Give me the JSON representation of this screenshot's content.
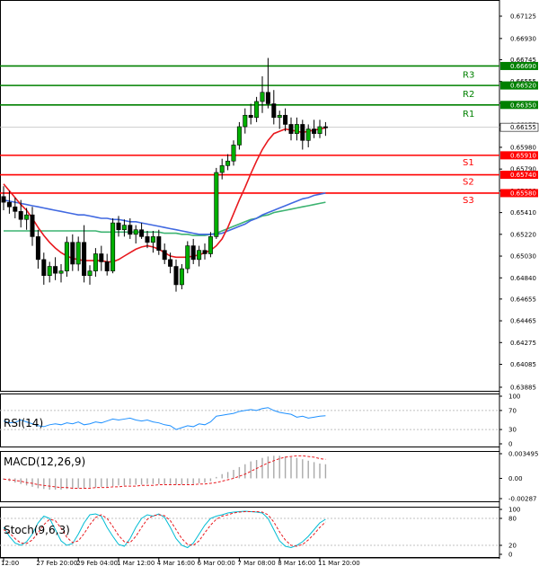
{
  "chart_data": {
    "type": "candlestick",
    "price_axis": {
      "ticks": [
        "0.67125",
        "0.66930",
        "0.66745",
        "0.66555",
        "0.66365",
        "0.66175",
        "0.65980",
        "0.65790",
        "0.65600",
        "0.65410",
        "0.65220",
        "0.65030",
        "0.64840",
        "0.64655",
        "0.64465",
        "0.64275",
        "0.64085",
        "0.63885"
      ],
      "ylim": [
        0.63885,
        0.67125
      ]
    },
    "time_axis": {
      "ticks": [
        "12:00",
        "27 Feb 20:00",
        "29 Feb 04:00",
        "1 Mar 12:00",
        "4 Mar 16:00",
        "6 Mar 00:00",
        "7 Mar 08:00",
        "8 Mar 16:00",
        "11 Mar 20:00"
      ]
    },
    "levels": [
      {
        "name": "R3",
        "value": "0.66690",
        "color": "#008000"
      },
      {
        "name": "R2",
        "value": "0.66520",
        "color": "#008000"
      },
      {
        "name": "R1",
        "value": "0.66350",
        "color": "#008000"
      },
      {
        "name": "S1",
        "value": "0.65910",
        "color": "#ff0000"
      },
      {
        "name": "S2",
        "value": "0.65740",
        "color": "#ff0000"
      },
      {
        "name": "S3",
        "value": "0.65580",
        "color": "#ff0000"
      }
    ],
    "current_price": "0.66155",
    "candles": [
      [
        0.6555,
        0.6564,
        0.6543,
        0.655
      ],
      [
        0.655,
        0.656,
        0.654,
        0.6546
      ],
      [
        0.6546,
        0.6554,
        0.6536,
        0.6542
      ],
      [
        0.6542,
        0.6552,
        0.6528,
        0.6535
      ],
      [
        0.6535,
        0.6545,
        0.6526,
        0.6539
      ],
      [
        0.6539,
        0.6546,
        0.6512,
        0.652
      ],
      [
        0.652,
        0.6526,
        0.6492,
        0.65
      ],
      [
        0.65,
        0.6506,
        0.6478,
        0.6486
      ],
      [
        0.6486,
        0.6498,
        0.648,
        0.6494
      ],
      [
        0.6494,
        0.6502,
        0.6482,
        0.6488
      ],
      [
        0.6488,
        0.6496,
        0.648,
        0.649
      ],
      [
        0.649,
        0.652,
        0.6485,
        0.6515
      ],
      [
        0.6515,
        0.6522,
        0.649,
        0.6496
      ],
      [
        0.6496,
        0.652,
        0.649,
        0.6515
      ],
      [
        0.6515,
        0.653,
        0.648,
        0.6486
      ],
      [
        0.6486,
        0.6495,
        0.6478,
        0.649
      ],
      [
        0.649,
        0.651,
        0.6485,
        0.6505
      ],
      [
        0.6505,
        0.6512,
        0.649,
        0.6498
      ],
      [
        0.6498,
        0.6505,
        0.6486,
        0.649
      ],
      [
        0.649,
        0.6536,
        0.6488,
        0.6532
      ],
      [
        0.6532,
        0.6538,
        0.652,
        0.6526
      ],
      [
        0.6526,
        0.6535,
        0.652,
        0.653
      ],
      [
        0.653,
        0.6536,
        0.6518,
        0.6522
      ],
      [
        0.6522,
        0.653,
        0.6514,
        0.6526
      ],
      [
        0.6526,
        0.6532,
        0.6518,
        0.652
      ],
      [
        0.652,
        0.6525,
        0.651,
        0.6515
      ],
      [
        0.6515,
        0.6525,
        0.6506,
        0.652
      ],
      [
        0.652,
        0.6526,
        0.6504,
        0.6508
      ],
      [
        0.6508,
        0.6514,
        0.6496,
        0.65
      ],
      [
        0.65,
        0.6506,
        0.6488,
        0.6494
      ],
      [
        0.6494,
        0.65,
        0.6472,
        0.6478
      ],
      [
        0.6478,
        0.6496,
        0.6474,
        0.6492
      ],
      [
        0.6492,
        0.6516,
        0.6488,
        0.6512
      ],
      [
        0.6512,
        0.6518,
        0.6496,
        0.65
      ],
      [
        0.65,
        0.6512,
        0.6494,
        0.6508
      ],
      [
        0.6508,
        0.6514,
        0.65,
        0.6505
      ],
      [
        0.6505,
        0.6524,
        0.6502,
        0.652
      ],
      [
        0.652,
        0.658,
        0.6518,
        0.6576
      ],
      [
        0.6576,
        0.6588,
        0.657,
        0.6582
      ],
      [
        0.6582,
        0.6592,
        0.6578,
        0.6586
      ],
      [
        0.6586,
        0.6604,
        0.6582,
        0.66
      ],
      [
        0.66,
        0.662,
        0.6596,
        0.6616
      ],
      [
        0.6616,
        0.6632,
        0.661,
        0.6626
      ],
      [
        0.6626,
        0.6636,
        0.6618,
        0.6624
      ],
      [
        0.6624,
        0.6642,
        0.662,
        0.6638
      ],
      [
        0.6638,
        0.666,
        0.6628,
        0.6646
      ],
      [
        0.6646,
        0.6676,
        0.6632,
        0.6636
      ],
      [
        0.6636,
        0.6648,
        0.6618,
        0.6624
      ],
      [
        0.6624,
        0.663,
        0.6614,
        0.6626
      ],
      [
        0.6626,
        0.6632,
        0.6612,
        0.6618
      ],
      [
        0.6618,
        0.6624,
        0.6604,
        0.661
      ],
      [
        0.661,
        0.6624,
        0.6604,
        0.6618
      ],
      [
        0.6618,
        0.6622,
        0.6596,
        0.6604
      ],
      [
        0.6604,
        0.6618,
        0.6598,
        0.6614
      ],
      [
        0.6614,
        0.6622,
        0.6606,
        0.661
      ],
      [
        0.661,
        0.6622,
        0.6606,
        0.6616
      ],
      [
        0.6616,
        0.662,
        0.6608,
        0.6615
      ]
    ],
    "ma_red": [
      0.6566,
      0.656,
      0.6554,
      0.6548,
      0.6543,
      0.6536,
      0.6528,
      0.6521,
      0.6515,
      0.651,
      0.6506,
      0.6503,
      0.6501,
      0.65,
      0.6499,
      0.6499,
      0.6499,
      0.6499,
      0.6498,
      0.6498,
      0.65,
      0.6503,
      0.6506,
      0.6509,
      0.6511,
      0.6512,
      0.6511,
      0.6509,
      0.6506,
      0.6503,
      0.6502,
      0.6502,
      0.6502,
      0.6503,
      0.6504,
      0.6506,
      0.6508,
      0.6512,
      0.6518,
      0.6528,
      0.654,
      0.6552,
      0.6563,
      0.6575,
      0.6586,
      0.6596,
      0.6604,
      0.661,
      0.6612,
      0.6614,
      0.6613,
      0.6612,
      0.6611,
      0.6612,
      0.6613,
      0.6614,
      0.6615
    ],
    "ma_blue": [
      0.6552,
      0.6551,
      0.655,
      0.6549,
      0.6548,
      0.6547,
      0.6546,
      0.6545,
      0.6544,
      0.6543,
      0.6542,
      0.6541,
      0.654,
      0.6539,
      0.6539,
      0.6538,
      0.6537,
      0.6536,
      0.6536,
      0.6535,
      0.6535,
      0.6534,
      0.6533,
      0.6533,
      0.6532,
      0.6531,
      0.653,
      0.6529,
      0.6528,
      0.6527,
      0.6526,
      0.6525,
      0.6524,
      0.6523,
      0.6522,
      0.6522,
      0.6522,
      0.6522,
      0.6523,
      0.6525,
      0.6527,
      0.6529,
      0.6531,
      0.6534,
      0.6536,
      0.6539,
      0.6541,
      0.6543,
      0.6545,
      0.6547,
      0.6549,
      0.6551,
      0.6553,
      0.6554,
      0.6556,
      0.6557,
      0.6558
    ],
    "ma_green": [
      0.6525,
      0.6525,
      0.6525,
      0.6525,
      0.6525,
      0.6525,
      0.6525,
      0.6525,
      0.6525,
      0.6525,
      0.6525,
      0.6525,
      0.6525,
      0.6525,
      0.6525,
      0.6525,
      0.6525,
      0.6524,
      0.6524,
      0.6524,
      0.6524,
      0.6524,
      0.6524,
      0.6524,
      0.6524,
      0.6524,
      0.6524,
      0.6524,
      0.6523,
      0.6523,
      0.6523,
      0.6522,
      0.6522,
      0.6521,
      0.6521,
      0.6521,
      0.6522,
      0.6523,
      0.6525,
      0.6527,
      0.6529,
      0.6531,
      0.6533,
      0.6535,
      0.6536,
      0.6538,
      0.6539,
      0.6541,
      0.6542,
      0.6543,
      0.6544,
      0.6545,
      0.6546,
      0.6547,
      0.6548,
      0.6549,
      0.655
    ],
    "rsi": {
      "label": "RSI(14)",
      "ticks": [
        "100",
        "70",
        "30",
        "0"
      ],
      "ylim": [
        0,
        100
      ],
      "values": [
        48,
        44,
        45,
        50,
        46,
        42,
        38,
        36,
        40,
        42,
        40,
        44,
        42,
        46,
        40,
        42,
        46,
        44,
        48,
        52,
        50,
        52,
        54,
        50,
        48,
        50,
        46,
        44,
        40,
        38,
        30,
        34,
        38,
        36,
        42,
        40,
        46,
        58,
        60,
        62,
        64,
        68,
        70,
        72,
        70,
        74,
        76,
        70,
        66,
        64,
        62,
        56,
        58,
        54,
        56,
        58,
        59
      ]
    },
    "macd": {
      "label": "MACD(12,26,9)",
      "ticks": [
        "0.003495",
        "0.00",
        "-0.00287"
      ],
      "ylim": [
        -0.00287,
        0.003495
      ],
      "hist": [
        -0.0002,
        -0.0004,
        -0.0006,
        -0.0008,
        -0.001,
        -0.0012,
        -0.0014,
        -0.0015,
        -0.0016,
        -0.0016,
        -0.0016,
        -0.0015,
        -0.0015,
        -0.0014,
        -0.0014,
        -0.0013,
        -0.0013,
        -0.0012,
        -0.0012,
        -0.0011,
        -0.001,
        -0.001,
        -0.0009,
        -0.0009,
        -0.0009,
        -0.0008,
        -0.0008,
        -0.0008,
        -0.0008,
        -0.0008,
        -0.0009,
        -0.0009,
        -0.0008,
        -0.0008,
        -0.0007,
        -0.0006,
        -0.0004,
        0.0002,
        0.0006,
        0.0009,
        0.0012,
        0.0016,
        0.002,
        0.0024,
        0.0026,
        0.0029,
        0.0031,
        0.0032,
        0.0032,
        0.0031,
        0.003,
        0.0029,
        0.0027,
        0.0025,
        0.0023,
        0.0021,
        0.002
      ],
      "signal": [
        -0.0001,
        -0.0002,
        -0.0003,
        -0.0004,
        -0.0006,
        -0.0007,
        -0.0009,
        -0.001,
        -0.0011,
        -0.0012,
        -0.0013,
        -0.0013,
        -0.0014,
        -0.0014,
        -0.0014,
        -0.0014,
        -0.0013,
        -0.0013,
        -0.0013,
        -0.0012,
        -0.0012,
        -0.0011,
        -0.0011,
        -0.0011,
        -0.001,
        -0.001,
        -0.001,
        -0.0009,
        -0.0009,
        -0.0009,
        -0.0009,
        -0.0009,
        -0.0009,
        -0.0009,
        -0.0008,
        -0.0008,
        -0.0007,
        -0.0006,
        -0.0004,
        -0.0002,
        0.0,
        0.0003,
        0.0006,
        0.001,
        0.0014,
        0.0018,
        0.0022,
        0.0025,
        0.0028,
        0.003,
        0.0031,
        0.0032,
        0.0032,
        0.0031,
        0.003,
        0.0028,
        0.0027
      ]
    },
    "stoch": {
      "label": "Stoch(9,6,3)",
      "ticks": [
        "100",
        "80",
        "20",
        "0"
      ],
      "ylim": [
        0,
        100
      ],
      "k": [
        60,
        40,
        25,
        20,
        28,
        45,
        70,
        85,
        80,
        55,
        30,
        20,
        24,
        45,
        70,
        88,
        90,
        85,
        60,
        40,
        22,
        18,
        35,
        60,
        80,
        88,
        85,
        90,
        82,
        60,
        35,
        20,
        15,
        25,
        45,
        65,
        80,
        85,
        88,
        92,
        94,
        95,
        96,
        95,
        94,
        92,
        80,
        55,
        30,
        18,
        15,
        20,
        28,
        40,
        55,
        70,
        78
      ],
      "d": [
        55,
        48,
        35,
        25,
        24,
        32,
        48,
        66,
        78,
        75,
        58,
        38,
        26,
        30,
        46,
        66,
        82,
        88,
        80,
        62,
        42,
        28,
        26,
        40,
        60,
        78,
        86,
        88,
        86,
        75,
        55,
        35,
        22,
        20,
        30,
        48,
        65,
        78,
        85,
        88,
        92,
        94,
        95,
        95,
        95,
        94,
        88,
        72,
        50,
        32,
        20,
        18,
        22,
        32,
        45,
        60,
        72
      ]
    }
  }
}
